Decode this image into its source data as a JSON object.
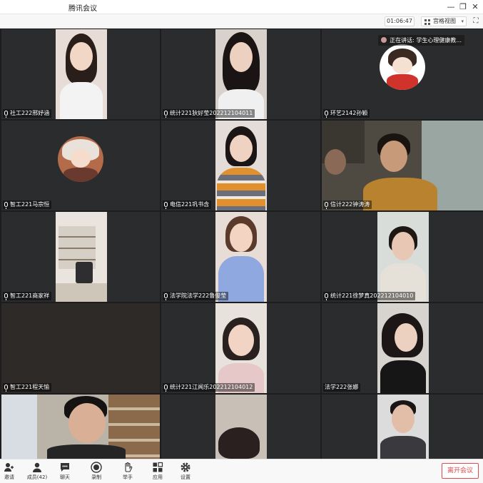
{
  "window": {
    "title": "腾讯会议",
    "minimize_glyph": "—",
    "restore_glyph": "❐",
    "close_glyph": "✕"
  },
  "toolbar": {
    "timer": "01:06:47",
    "view_label": "宫格视图",
    "view_icon": "grid-icon",
    "fullscreen_glyph": "⛶"
  },
  "speaking": {
    "label": "正在讲话: 学生心理健康教..."
  },
  "tiles": [
    {
      "name": "社工222邢妤涵",
      "muted_icon": false
    },
    {
      "name": "统计221狄好莹202212104011",
      "muted_icon": false
    },
    {
      "name": "环艺2142孙颖",
      "muted_icon": false
    },
    {
      "name": "智工221马宗恒",
      "muted_icon": true
    },
    {
      "name": "电信221巩书含",
      "muted_icon": false
    },
    {
      "name": "信计222钟涛涛",
      "muted_icon": true
    },
    {
      "name": "智工221商家祥",
      "muted_icon": true
    },
    {
      "name": "法学院法学222鲁俊莹",
      "muted_icon": false
    },
    {
      "name": "统计221徐梦真202212104010",
      "muted_icon": false
    },
    {
      "name": "智工221程天愉",
      "muted_icon": true
    },
    {
      "name": "统计221江闻乐202212104012",
      "muted_icon": false
    },
    {
      "name": "法学222张娜",
      "muted_icon": false
    },
    {
      "name": "",
      "muted_icon": false
    },
    {
      "name": "",
      "muted_icon": false
    },
    {
      "name": "",
      "muted_icon": false
    }
  ],
  "bottombar": {
    "invite": "邀请",
    "members": "成员(42)",
    "chat": "聊天",
    "record": "录制",
    "raise_hand": "举手",
    "apps": "应用",
    "settings": "设置",
    "leave": "离开会议"
  }
}
